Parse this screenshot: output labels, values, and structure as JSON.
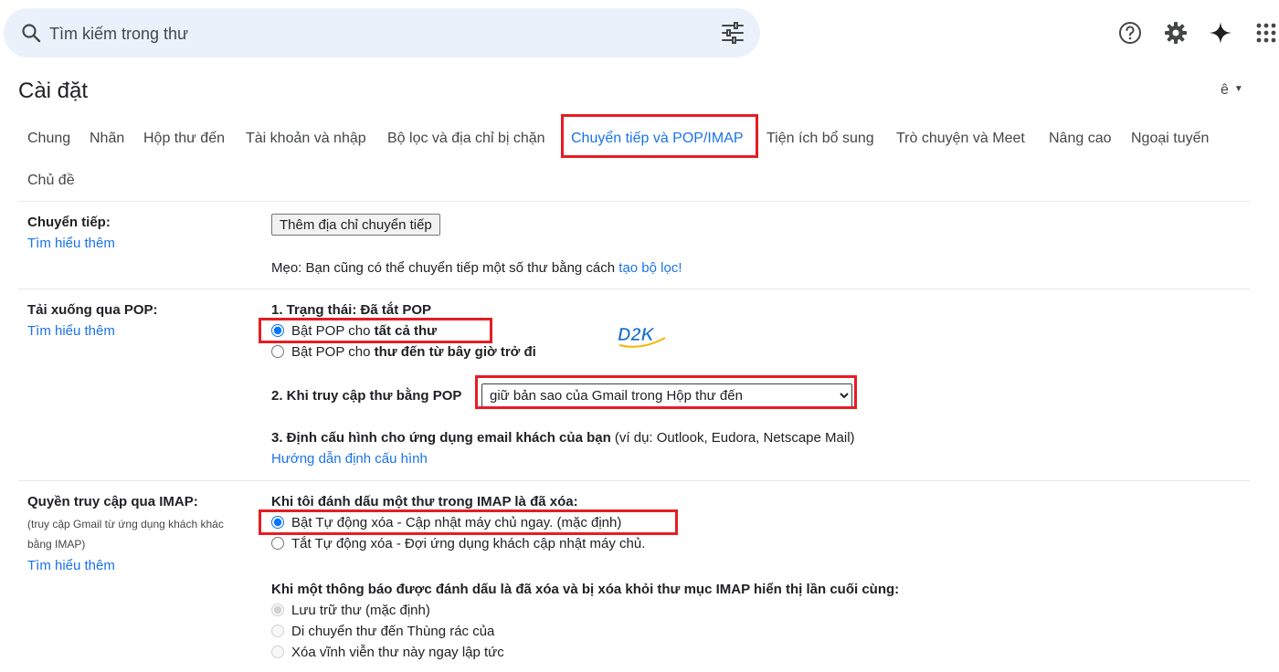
{
  "search": {
    "placeholder": "Tìm kiếm trong thư"
  },
  "header": {
    "title": "Cài đặt",
    "language": "ê"
  },
  "tabs": [
    {
      "label": "Chung"
    },
    {
      "label": "Nhãn"
    },
    {
      "label": "Hộp thư đến"
    },
    {
      "label": "Tài khoản và nhập"
    },
    {
      "label": "Bộ lọc và địa chỉ bị chặn"
    },
    {
      "label": "Chuyển tiếp và POP/IMAP"
    },
    {
      "label": "Tiện ích bổ sung"
    },
    {
      "label": "Trò chuyện và Meet"
    },
    {
      "label": "Nâng cao"
    },
    {
      "label": "Ngoại tuyến"
    },
    {
      "label": "Chủ đề"
    }
  ],
  "forwarding": {
    "label": "Chuyển tiếp:",
    "learn_more": "Tìm hiểu thêm",
    "add_button": "Thêm địa chỉ chuyển tiếp",
    "tip_prefix": "Mẹo: Bạn cũng có thể chuyển tiếp một số thư bằng cách ",
    "tip_link": "tạo bộ lọc!"
  },
  "pop": {
    "label": "Tải xuống qua POP:",
    "learn_more": "Tìm hiểu thêm",
    "status": "1. Trạng thái: Đã tắt POP",
    "option1_prefix": "Bật POP cho ",
    "option1_bold": "tất cả thư",
    "option2_prefix": "Bật POP cho ",
    "option2_bold": "thư đến từ bây giờ trở đi",
    "access_label": "2. Khi truy cập thư bằng POP",
    "access_value": "giữ bản sao của Gmail trong Hộp thư đến",
    "config_bold": "3. Định cấu hình cho ứng dụng email khách của bạn",
    "config_rest": " (ví dụ: Outlook, Eudora, Netscape Mail)",
    "config_link": "Hướng dẫn định cấu hình",
    "logo_text": "D2K"
  },
  "imap": {
    "label": "Quyền truy cập qua IMAP:",
    "sub1": "(truy cập Gmail từ ứng dụng khách khác",
    "sub2": "bằng IMAP)",
    "learn_more": "Tìm hiểu thêm",
    "delete_heading": "Khi tôi đánh dấu một thư trong IMAP là đã xóa:",
    "auto_on": "Bật Tự động xóa - Cập nhật máy chủ ngay. (mặc định)",
    "auto_off": "Tắt Tự động xóa - Đợi ứng dụng khách cập nhật máy chủ.",
    "expunge_heading": "Khi một thông báo được đánh dấu là đã xóa và bị xóa khỏi thư mục IMAP hiển thị lần cuối cùng:",
    "expunge_opt1": "Lưu trữ thư (mặc định)",
    "expunge_opt2": "Di chuyển thư đến Thùng rác của",
    "expunge_opt3": "Xóa vĩnh viễn thư này ngay lập tức"
  },
  "colors": {
    "accent": "#1a73e8",
    "highlight": "#e31e24",
    "search_bg": "#eaf1fb"
  }
}
